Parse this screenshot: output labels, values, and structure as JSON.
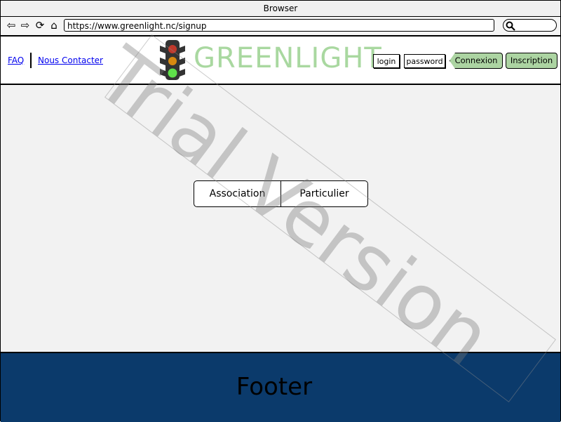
{
  "window": {
    "title": "Browser"
  },
  "navigation": {
    "back_icon": "back-arrow-icon",
    "forward_icon": "forward-arrow-icon",
    "reload_icon": "reload-icon",
    "home_icon": "home-icon",
    "url": "https://www.greenlight.nc/signup",
    "search_placeholder": ""
  },
  "header": {
    "links": {
      "faq": "FAQ",
      "contact": "Nous Contacter"
    },
    "logo_text": "GREENLIGHT",
    "logo_icon": "traffic-light-icon",
    "login_label": "login",
    "password_label": "password",
    "connexion_label": "Connexion",
    "inscription_label": "Inscription"
  },
  "main": {
    "account_types": [
      "Association",
      "Particulier"
    ]
  },
  "footer": {
    "label": "Footer"
  },
  "watermark": {
    "text": "Trial Version"
  },
  "colors": {
    "brand_green": "#a9d8a0",
    "button_green": "#acd4a2",
    "footer_blue": "#0b3a6b",
    "link_blue": "#0000ee"
  }
}
